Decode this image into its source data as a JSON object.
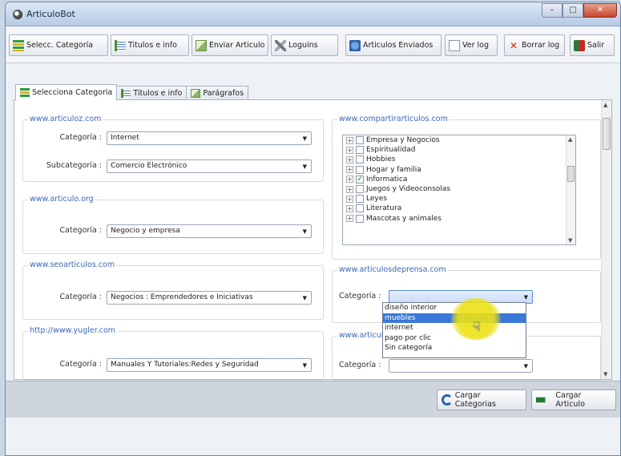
{
  "window": {
    "title": "ArticuloBot",
    "min": "–",
    "max": "□",
    "close": "✕"
  },
  "toolbar": {
    "buttons": [
      {
        "label": "Selecc. Categoría",
        "icon": "category-icon"
      },
      {
        "label": "Titulos e info",
        "icon": "list-icon"
      },
      {
        "label": "Enviar Articulo",
        "icon": "send-mail-icon"
      },
      {
        "label": "Loguins",
        "icon": "tools-icon"
      },
      {
        "label": "Articulos Enviados",
        "icon": "globe-icon"
      },
      {
        "label": "Ver log",
        "icon": "document-icon"
      },
      {
        "label": "Borrar log",
        "icon": "delete-icon"
      },
      {
        "label": "Salir",
        "icon": "exit-icon"
      }
    ]
  },
  "tabs": [
    {
      "label": "Selecciona Categoria",
      "active": true
    },
    {
      "label": "Titulos e info",
      "active": false
    },
    {
      "label": "Parágrafos",
      "active": false
    }
  ],
  "groups": {
    "articuloz": {
      "title": "www.articuloz.com",
      "categoria_label": "Categoría :",
      "categoria_value": "Internet",
      "subcategoria_label": "Subcategoría :",
      "subcategoria_value": "Comercio Electrónico"
    },
    "articulo_org": {
      "title": "www.articulo.org",
      "categoria_label": "Categoría :",
      "categoria_value": "Negocio y empresa"
    },
    "seoarticulos": {
      "title": "www.seoarticulos.com",
      "categoria_label": "Categoría :",
      "categoria_value": "Negocios : Emprendedores e Iniciativas"
    },
    "yugler": {
      "title": "http://www.yugler.com",
      "categoria_label": "Categoría :",
      "categoria_value": "Manuales Y Tutoriales:Redes y Seguridad"
    },
    "compartirarticulos": {
      "title": "www.compartirarticulos.com",
      "items": [
        {
          "label": "Empresa y Negocios",
          "checked": false
        },
        {
          "label": "Espiritualidad",
          "checked": false
        },
        {
          "label": "Hobbies",
          "checked": false
        },
        {
          "label": "Hogar y familia",
          "checked": false
        },
        {
          "label": "Informatica",
          "checked": true
        },
        {
          "label": "Juegos y Videoconsolas",
          "checked": false
        },
        {
          "label": "Leyes",
          "checked": false
        },
        {
          "label": "Literatura",
          "checked": false
        },
        {
          "label": "Mascotas y animales",
          "checked": false
        }
      ]
    },
    "articulosdeprensa": {
      "title": "www.articulosdeprensa.com",
      "categoria_label": "Categoría :",
      "categoria_value": "",
      "dropdown_options": [
        "diseño interior",
        "muebles",
        "internet",
        "pago por clic",
        "Sin categoría"
      ],
      "dropdown_selected_index": 1
    },
    "articulo_bottom": {
      "title": "www.articulo",
      "categoria_label": "Categoría :",
      "categoria_value": ""
    }
  },
  "bottom": {
    "cargar_label": "Cargar Categorias",
    "cargar_articulo_label": "Cargar Articulo"
  }
}
